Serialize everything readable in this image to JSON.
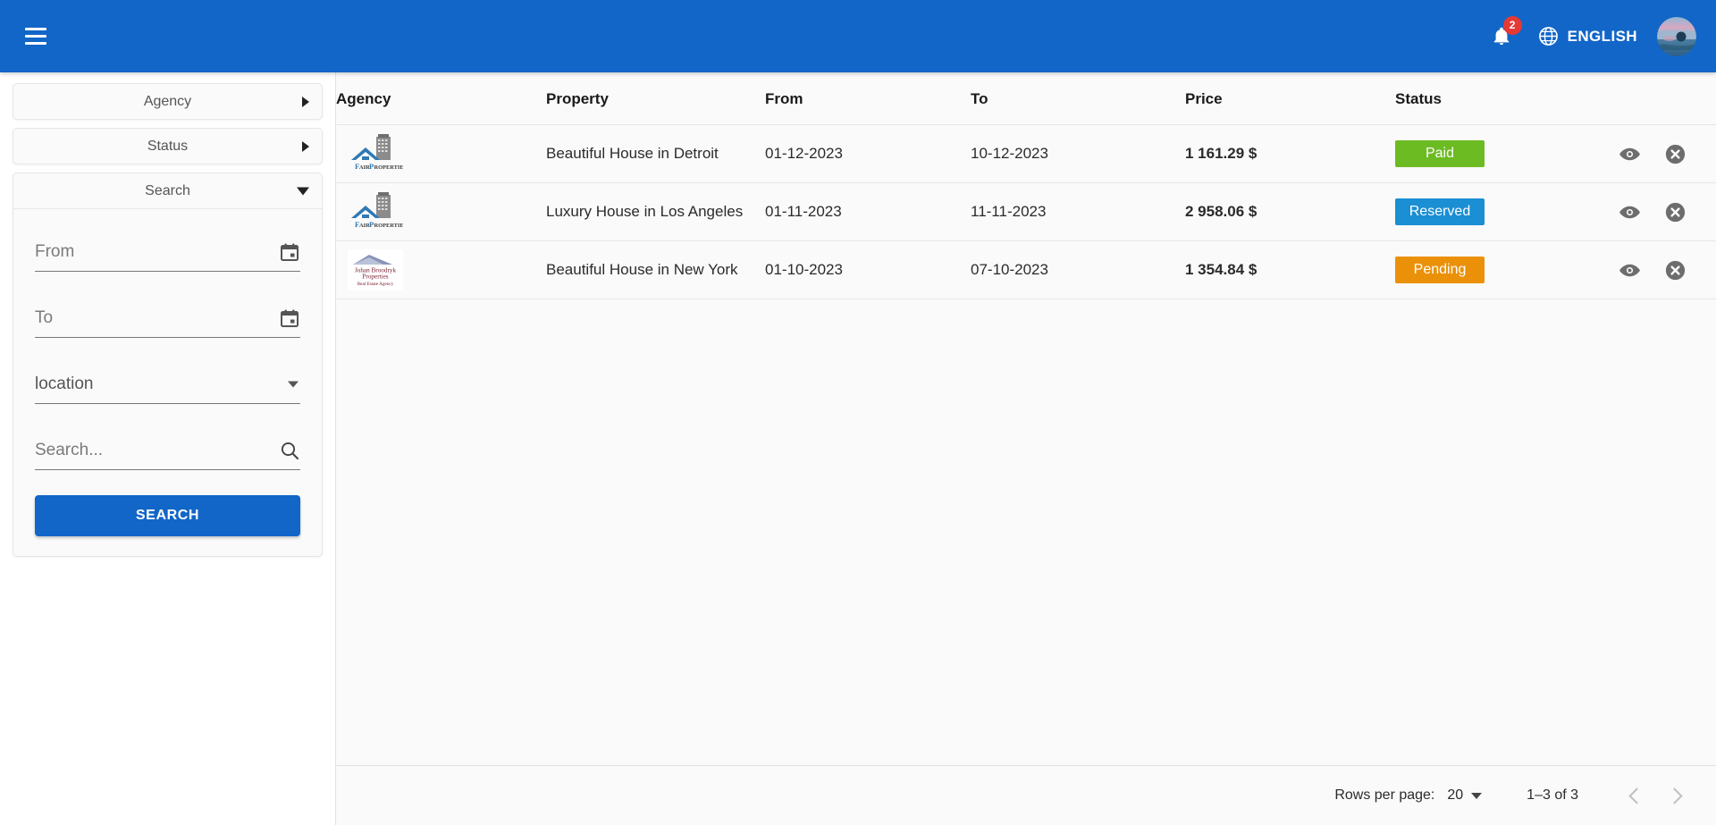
{
  "appbar": {
    "menu_icon": "hamburger-menu-icon",
    "notifications": {
      "icon": "bell-icon",
      "count": "2"
    },
    "language": {
      "icon": "globe-icon",
      "label": "ENGLISH"
    },
    "avatar": {
      "icon": "user-avatar"
    },
    "bg_color": "#1266c8"
  },
  "sidebar": {
    "panels": [
      {
        "title": "Agency",
        "expanded": false,
        "caret": "caret-right-icon"
      },
      {
        "title": "Status",
        "expanded": false,
        "caret": "caret-right-icon"
      },
      {
        "title": "Search",
        "expanded": true,
        "caret": "caret-down-icon"
      }
    ],
    "search_form": {
      "from": {
        "placeholder": "From",
        "value": "",
        "icon": "calendar-icon"
      },
      "to": {
        "placeholder": "To",
        "value": "",
        "icon": "calendar-icon"
      },
      "location": {
        "label": "location",
        "value": "",
        "icon": "chevron-down-icon"
      },
      "keyword": {
        "placeholder": "Search...",
        "value": "",
        "icon": "search-icon"
      },
      "submit_label": "SEARCH",
      "submit_color": "#1266c8"
    }
  },
  "table": {
    "columns": [
      "Agency",
      "Property",
      "From",
      "To",
      "Price",
      "Status"
    ],
    "rows": [
      {
        "agency_logo": "fair-properties-logo",
        "agency_name": "FairProperties",
        "property": "Beautiful House in Detroit",
        "from": "01-12-2023",
        "to": "10-12-2023",
        "price": "1 161.29 $",
        "status": "Paid",
        "status_color": "#6cbb23",
        "view_icon": "eye-icon",
        "cancel_icon": "cancel-circle-icon"
      },
      {
        "agency_logo": "fair-properties-logo",
        "agency_name": "FairProperties",
        "property": "Luxury House in Los Angeles",
        "from": "01-11-2023",
        "to": "11-11-2023",
        "price": "2 958.06 $",
        "status": "Reserved",
        "status_color": "#1a8fd4",
        "view_icon": "eye-icon",
        "cancel_icon": "cancel-circle-icon"
      },
      {
        "agency_logo": "johan-broodryk-properties-logo",
        "agency_name": "Johan Broodryk Properties Real Estate Agency",
        "property": "Beautiful House in New York",
        "from": "01-10-2023",
        "to": "07-10-2023",
        "price": "1 354.84 $",
        "status": "Pending",
        "status_color": "#ea9109",
        "view_icon": "eye-icon",
        "cancel_icon": "cancel-circle-icon"
      }
    ]
  },
  "pagination": {
    "rows_per_page_label": "Rows per page:",
    "rows_per_page_value": "20",
    "range_label": "1–3 of 3",
    "prev_icon": "chevron-left-icon",
    "next_icon": "chevron-right-icon"
  }
}
